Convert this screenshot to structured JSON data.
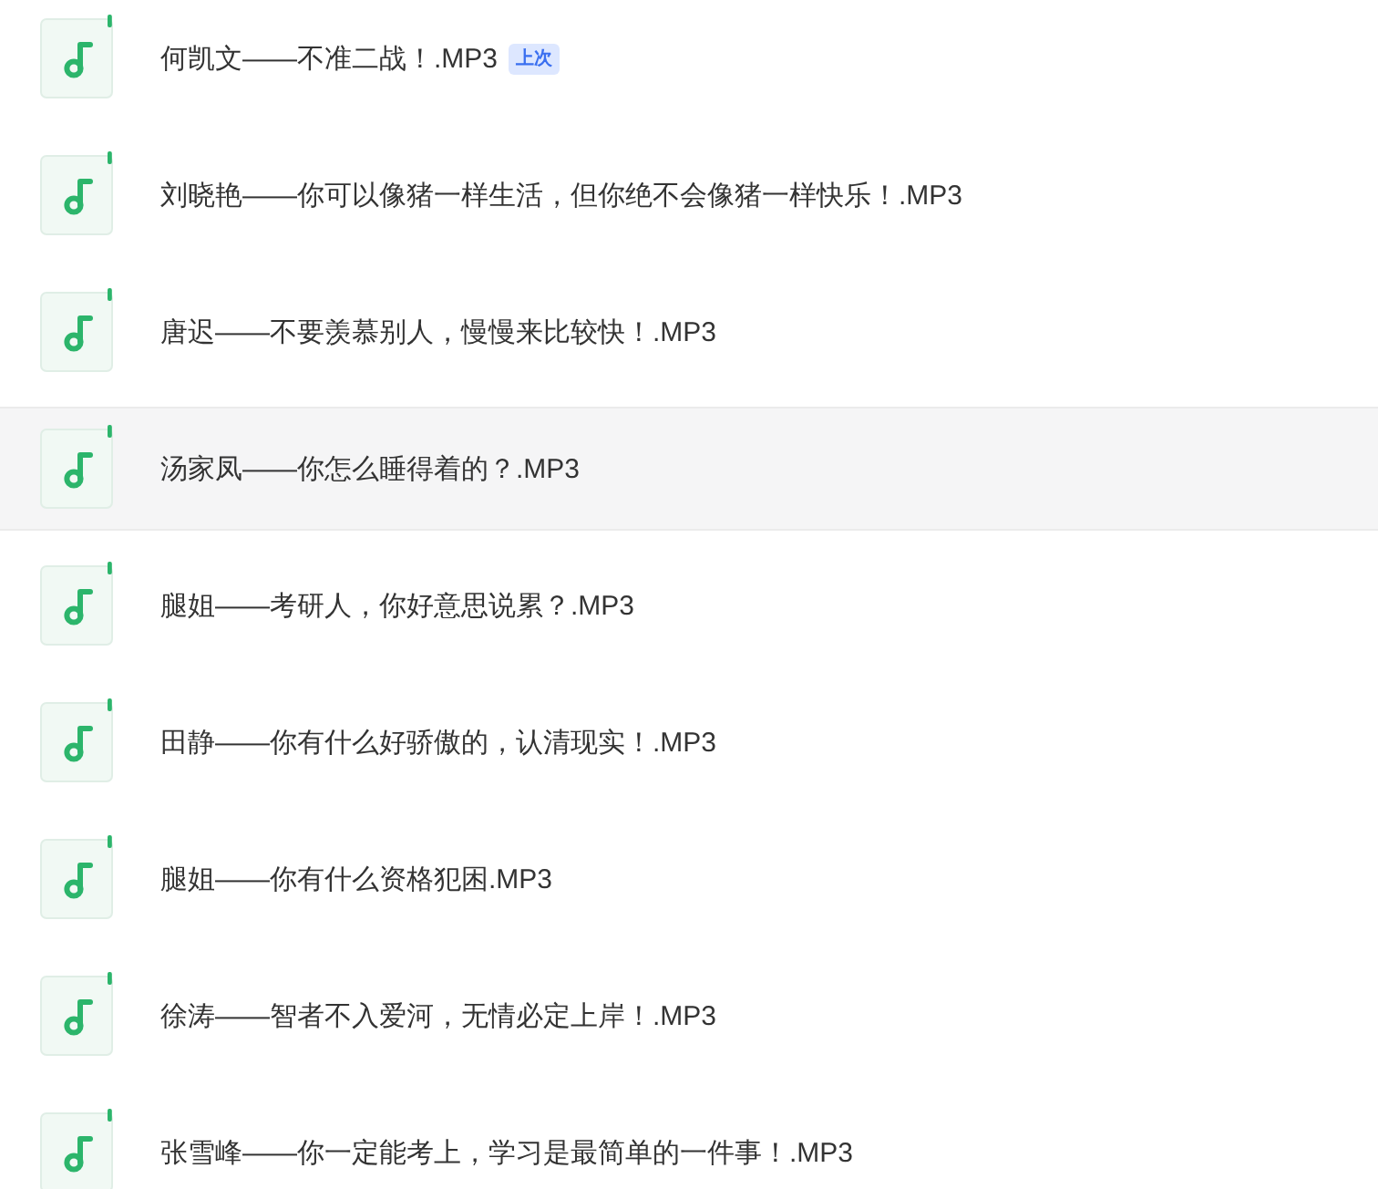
{
  "files": [
    {
      "name": "何凯文——不准二战！.MP3",
      "badge": "上次",
      "selected": false
    },
    {
      "name": "刘晓艳——你可以像猪一样生活，但你绝不会像猪一样快乐！.MP3",
      "selected": false
    },
    {
      "name": "唐迟——不要羡慕别人，慢慢来比较快！.MP3",
      "selected": false
    },
    {
      "name": "汤家凤——你怎么睡得着的？.MP3",
      "selected": true
    },
    {
      "name": "腿姐——考研人，你好意思说累？.MP3",
      "selected": false
    },
    {
      "name": "田静——你有什么好骄傲的，认清现实！.MP3",
      "selected": false
    },
    {
      "name": "腿姐——你有什么资格犯困.MP3",
      "selected": false
    },
    {
      "name": "徐涛——智者不入爱河，无情必定上岸！.MP3",
      "selected": false
    },
    {
      "name": "张雪峰——你一定能考上，学习是最简单的一件事！.MP3",
      "selected": false
    }
  ]
}
